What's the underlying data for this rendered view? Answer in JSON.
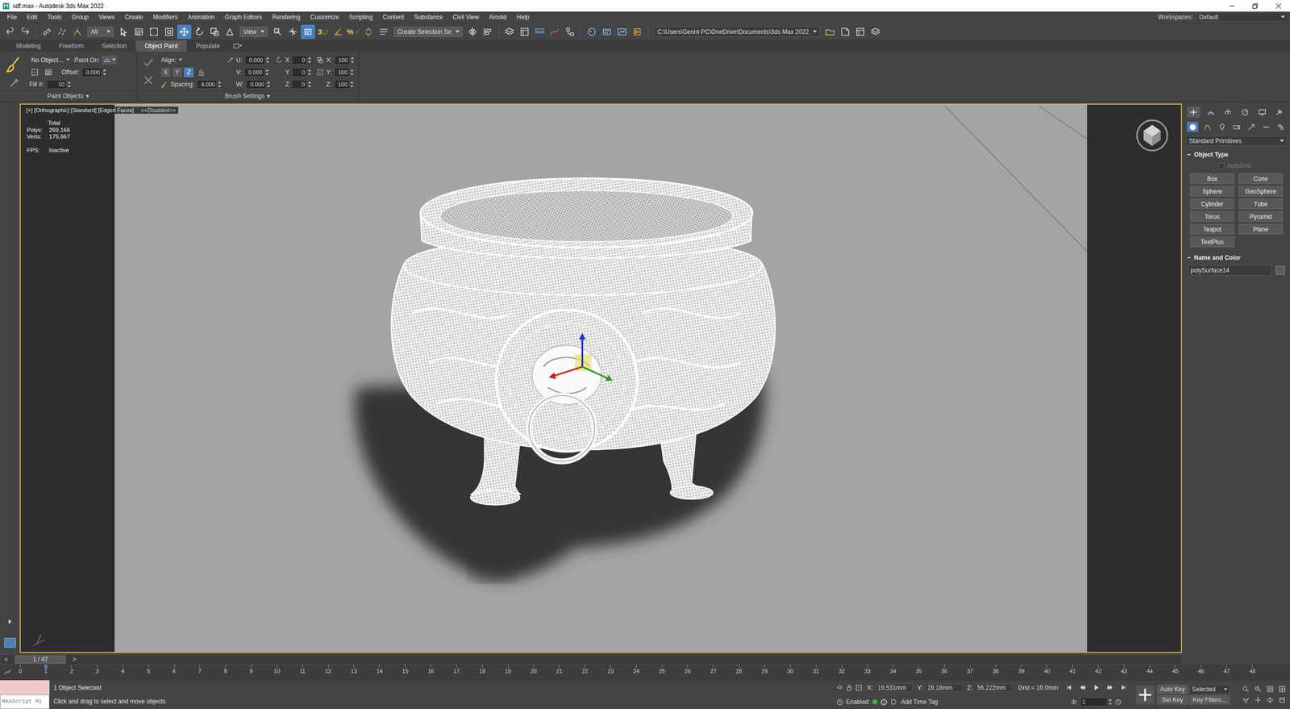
{
  "window": {
    "title": "sdf.max - Autodesk 3ds Max 2022"
  },
  "menu": {
    "items": [
      "File",
      "Edit",
      "Tools",
      "Group",
      "Views",
      "Create",
      "Modifiers",
      "Animation",
      "Graph Editors",
      "Rendering",
      "Customize",
      "Scripting",
      "Content",
      "Substance",
      "Civil View",
      "Arnold",
      "Help"
    ],
    "workspaces_label": "Workspaces:",
    "workspace": "Default"
  },
  "toolbar": {
    "items": [
      {
        "kind": "undo",
        "selected": false
      },
      {
        "kind": "redo",
        "selected": false
      },
      {
        "kind": "sep"
      },
      {
        "kind": "link",
        "selected": false
      },
      {
        "kind": "unlink",
        "selected": false
      },
      {
        "kind": "bind",
        "selected": false
      },
      {
        "kind": "dropdown",
        "value": "All"
      },
      {
        "kind": "select",
        "selected": false
      },
      {
        "kind": "selname",
        "selected": false
      },
      {
        "kind": "rect",
        "selected": false
      },
      {
        "kind": "window",
        "selected": false
      },
      {
        "kind": "move",
        "selected": true
      },
      {
        "kind": "rotate",
        "selected": false
      },
      {
        "kind": "scale",
        "selected": false
      },
      {
        "kind": "place",
        "selected": false
      },
      {
        "kind": "dropdown",
        "value": "View"
      },
      {
        "kind": "pivot",
        "selected": false
      },
      {
        "kind": "manip",
        "selected": false
      },
      {
        "kind": "keyselect",
        "selected": true
      },
      {
        "kind": "snap",
        "label": "3",
        "selected": false
      },
      {
        "kind": "angle",
        "selected": false
      },
      {
        "kind": "percent",
        "label": "%",
        "selected": false
      },
      {
        "kind": "spinner",
        "selected": false
      },
      {
        "kind": "named",
        "selected": false
      },
      {
        "kind": "dropdown",
        "value": "Create Selection Se"
      },
      {
        "kind": "mirror",
        "selected": false
      },
      {
        "kind": "align",
        "selected": false
      },
      {
        "kind": "sep"
      },
      {
        "kind": "layer",
        "selected": false
      },
      {
        "kind": "explorer",
        "selected": false
      },
      {
        "kind": "ribbon",
        "selected": false
      },
      {
        "kind": "curve",
        "selected": false
      },
      {
        "kind": "schematic",
        "selected": false
      },
      {
        "kind": "sep"
      },
      {
        "kind": "material",
        "selected": false
      },
      {
        "kind": "rendersetup",
        "selected": false
      },
      {
        "kind": "frame",
        "selected": false
      },
      {
        "kind": "render",
        "selected": false
      },
      {
        "kind": "sep"
      },
      {
        "kind": "path",
        "value": "C:\\Users\\Gennt-PC\\OneDrive\\Documents\\3ds Max 2022"
      },
      {
        "kind": "folder",
        "selected": false
      },
      {
        "kind": "project",
        "selected": false
      },
      {
        "kind": "explorer",
        "selected": false
      },
      {
        "kind": "layer",
        "selected": false
      }
    ]
  },
  "ribbon": {
    "tabs": [
      {
        "label": "Modeling",
        "selected": false
      },
      {
        "label": "Freeform",
        "selected": false
      },
      {
        "label": "Selection",
        "selected": false
      },
      {
        "label": "Object Paint",
        "selected": true
      },
      {
        "label": "Populate",
        "selected": false
      }
    ],
    "paint_objects": {
      "object": "No Object...",
      "paint_on_label": "Paint On:",
      "offset_label": "Offset:",
      "offset": "0.000",
      "fill_label": "Fill #:",
      "fill": "10",
      "panel_label": "Paint Objects",
      "expander": "▾"
    },
    "brush_settings": {
      "align_label": "Align:",
      "axes": [
        {
          "label": "X",
          "selected": false
        },
        {
          "label": "Y",
          "selected": false
        },
        {
          "label": "Z",
          "selected": true
        }
      ],
      "spacing_label": "Spacing:",
      "spacing": "4.000",
      "offsets": [
        {
          "label": "U:",
          "value": "0.000"
        },
        {
          "label": "V:",
          "value": "0.000"
        },
        {
          "label": "W:",
          "value": "0.000"
        }
      ],
      "rotations": [
        {
          "label": "X",
          "value": "0"
        },
        {
          "label": "Y",
          "value": "0"
        },
        {
          "label": "Z",
          "value": "0"
        }
      ],
      "scales": [
        {
          "label": "X:",
          "value": "100"
        },
        {
          "label": "Y:",
          "value": "100"
        },
        {
          "label": "Z:",
          "value": "100"
        }
      ],
      "panel_label": "Brush Settings",
      "expander": "▾"
    }
  },
  "viewport": {
    "label": "[+] [Orthographic] [Standard] [Edged Faces]",
    "disabled_label": "<<Disabled>>",
    "active": true,
    "stats": {
      "title": "Total",
      "rows": [
        {
          "label": "Polys:",
          "value": "269,166"
        },
        {
          "label": "Verts:",
          "value": "175,667"
        }
      ],
      "fps_label": "FPS:",
      "fps": "Inactive"
    }
  },
  "command_panel": {
    "tabs": [
      {
        "kind": "create",
        "selected": true
      },
      {
        "kind": "modify",
        "selected": false
      },
      {
        "kind": "hierarchy",
        "selected": false
      },
      {
        "kind": "motion",
        "selected": false
      },
      {
        "kind": "display",
        "selected": false
      },
      {
        "kind": "utilities",
        "selected": false
      }
    ],
    "categories": [
      {
        "kind": "geometry",
        "selected": true
      },
      {
        "kind": "shapes",
        "selected": false
      },
      {
        "kind": "lights",
        "selected": false
      },
      {
        "kind": "cameras",
        "selected": false
      },
      {
        "kind": "helpers",
        "selected": false
      },
      {
        "kind": "spacewarps",
        "selected": false
      },
      {
        "kind": "systems",
        "selected": false
      }
    ],
    "category": "Standard Primitives",
    "object_type": {
      "title": "Object Type",
      "autogrid": {
        "label": "AutoGrid",
        "checked": false,
        "disabled": true
      },
      "buttons": [
        "Box",
        "Cone",
        "Sphere",
        "GeoSphere",
        "Cylinder",
        "Tube",
        "Torus",
        "Pyramid",
        "Teapot",
        "Plane",
        "TextPlus"
      ]
    },
    "name_and_color": {
      "title": "Name and Color",
      "name": "polySurface14",
      "swatch": "#5c5c5c"
    }
  },
  "time_slider": {
    "prev": "<",
    "next": ">",
    "label": "1 / 47",
    "level": 0.0
  },
  "track_bar": {
    "ticks": [
      "0",
      "1",
      "2",
      "3",
      "4",
      "5",
      "6",
      "7",
      "8",
      "9",
      "10",
      "11",
      "12",
      "13",
      "14",
      "15",
      "16",
      "17",
      "18",
      "19",
      "20",
      "21",
      "22",
      "23",
      "24",
      "25",
      "26",
      "27",
      "28",
      "29",
      "30",
      "31",
      "32",
      "33",
      "34",
      "35",
      "36",
      "37",
      "38",
      "39",
      "40",
      "41",
      "42",
      "43",
      "44",
      "45",
      "46",
      "47",
      "48"
    ],
    "current_index": 1
  },
  "status_bar": {
    "maxscript": "MAXScript Mi",
    "selection": "1 Object Selected",
    "prompt": "Click and drag to select and move objects",
    "coords": [
      {
        "label": "X:",
        "value": "19.531mm"
      },
      {
        "label": "Y:",
        "value": "19.18mm"
      },
      {
        "label": "Z:",
        "value": "56.222mm"
      }
    ],
    "grid": "Grid = 10.0mm",
    "enabled_label": "Enabled:",
    "enabled": true,
    "time_tag": "Add Time Tag",
    "auto_key": "Auto Key",
    "key_mode": "Selected",
    "set_key": "Set Key",
    "key_filters": "Key Filters...",
    "frame": "1"
  }
}
